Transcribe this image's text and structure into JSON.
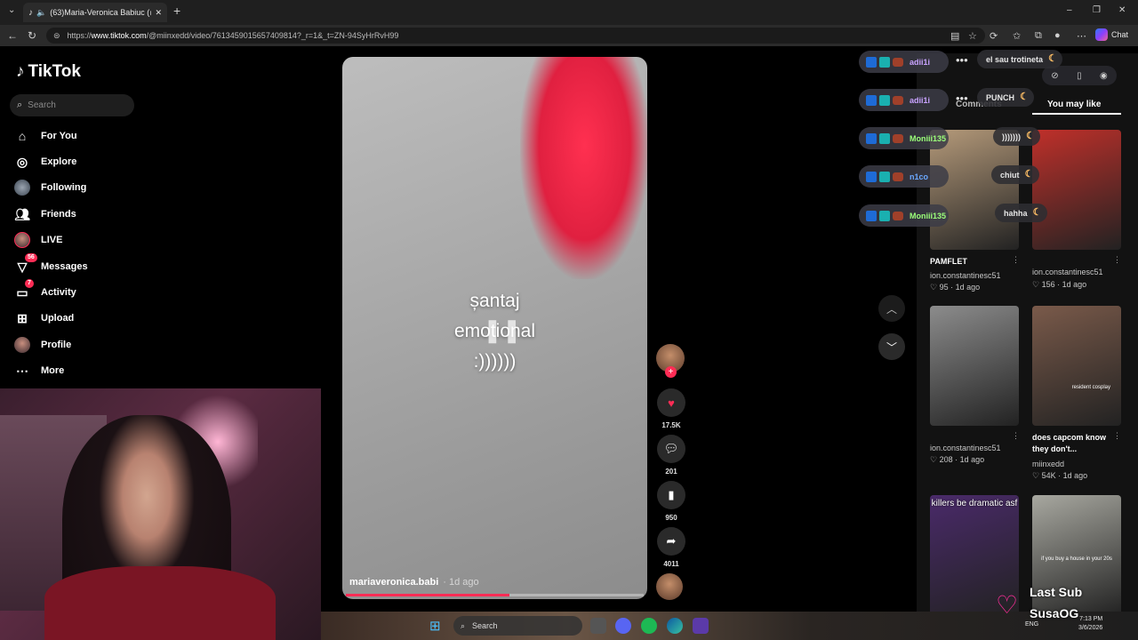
{
  "browser": {
    "tab_title": "(63)Maria-Veronica Babiuc (@",
    "url_prefix": "https://",
    "url_domain": "www.tiktok.com",
    "url_rest": "/@miinxedd/video/7613459015657409814?_r=1&_t=ZN-94SyHrRvH99",
    "chat_label": "Chat"
  },
  "tiktok": {
    "logo": "TikTok",
    "search_placeholder": "Search",
    "nav": [
      {
        "label": "For You",
        "icon": "home-icon"
      },
      {
        "label": "Explore",
        "icon": "compass-icon"
      },
      {
        "label": "Following",
        "icon": "following-avatar-icon"
      },
      {
        "label": "Friends",
        "icon": "friends-icon"
      },
      {
        "label": "LIVE",
        "icon": "live-avatar-icon"
      },
      {
        "label": "Messages",
        "icon": "messages-icon",
        "badge": "56"
      },
      {
        "label": "Activity",
        "icon": "activity-icon",
        "badge": "7"
      },
      {
        "label": "Upload",
        "icon": "upload-icon"
      },
      {
        "label": "Profile",
        "icon": "profile-avatar-icon"
      },
      {
        "label": "More",
        "icon": "more-icon"
      }
    ]
  },
  "video": {
    "caption_line1": "șantaj",
    "caption_line2": "emotional",
    "caption_line3": ":))))))",
    "username": "mariaveronica.babi",
    "date": "· 1d ago",
    "progress": 0.55,
    "likes": "17.5K",
    "comments": "201",
    "saves": "950",
    "shares": "4011"
  },
  "panel": {
    "tab_comments": "Comments",
    "tab_you_may_like": "You may like",
    "videos": [
      {
        "title": "PAMFLET",
        "author": "ion.constantinesc51",
        "likes": "95",
        "date": "1d ago",
        "overlay": "",
        "color": "#b59a7a"
      },
      {
        "title": "",
        "author": "ion.constantinesc51",
        "likes": "156",
        "date": "1d ago",
        "overlay": "",
        "color": "#c0302a"
      },
      {
        "title": "",
        "author": "ion.constantinesc51",
        "likes": "208",
        "date": "1d ago",
        "overlay": "",
        "color": "#8c8c8c"
      },
      {
        "title": "does capcom know they don't...",
        "author": "miinxedd",
        "likes": "54K",
        "date": "1d ago",
        "overlay": "",
        "subtext": "resident cosplay",
        "color": "#7a5a4a"
      },
      {
        "title": "",
        "author": "",
        "likes": "",
        "date": "",
        "overlay": "killers be dramatic asf",
        "color": "#4a2a6a"
      },
      {
        "title": "",
        "author": "",
        "likes": "",
        "date": "",
        "overlay": "",
        "subtext": "if you buy a house in your 20s",
        "color": "#a8a8a0"
      }
    ]
  },
  "stream_chat": {
    "pills": [
      {
        "name": "adii1i",
        "color": "#c9a3ff"
      },
      {
        "name": "adii1i",
        "color": "#c9a3ff"
      },
      {
        "name": "Moniii135",
        "color": "#9bff7a"
      },
      {
        "name": "n1co",
        "color": "#6aa8ff"
      },
      {
        "name": "Moniii135",
        "color": "#9bff7a"
      }
    ],
    "bubbles": [
      "el sau trotineta",
      "PUNCH",
      ")))))))",
      "chiut",
      "hahha"
    ],
    "last_sub_label": "Last Sub",
    "last_sub_name": "SusaOG"
  },
  "taskbar": {
    "search_label": "Search",
    "lang": "ENG",
    "time": "7:13 PM",
    "date": "3/6/2026"
  }
}
